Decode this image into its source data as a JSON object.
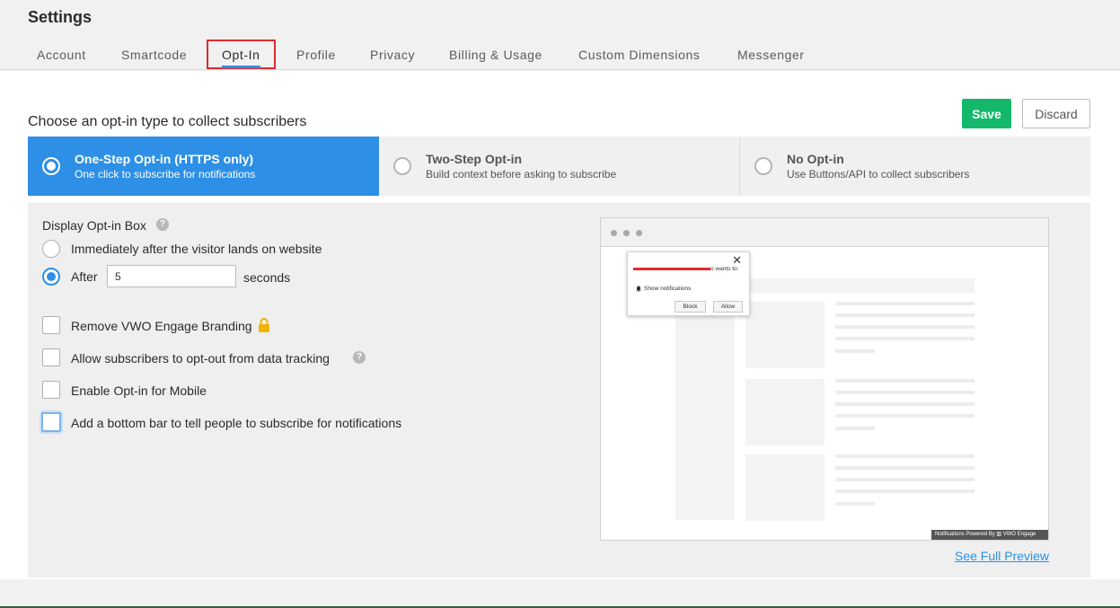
{
  "header": {
    "title": "Settings",
    "tabs": [
      {
        "label": "Account"
      },
      {
        "label": "Smartcode"
      },
      {
        "label": "Opt-In"
      },
      {
        "label": "Profile"
      },
      {
        "label": "Privacy"
      },
      {
        "label": "Billing & Usage"
      },
      {
        "label": "Custom Dimensions"
      },
      {
        "label": "Messenger"
      }
    ],
    "active_tab": "Opt-In"
  },
  "optin": {
    "section_title": "Choose an opt-in type to collect subscribers",
    "save_label": "Save",
    "discard_label": "Discard",
    "types": [
      {
        "title": "One-Step Opt-in (HTTPS only)",
        "desc": "One click to subscribe for notifications",
        "selected": true
      },
      {
        "title": "Two-Step Opt-in",
        "desc": "Build context before asking to subscribe",
        "selected": false
      },
      {
        "title": "No Opt-in",
        "desc": "Use Buttons/API to collect subscribers",
        "selected": false
      }
    ]
  },
  "display": {
    "label": "Display Opt-in Box",
    "help_glyph": "?",
    "option_immediately": "Immediately after the visitor lands on website",
    "option_after": "After",
    "delay_value": "5",
    "delay_unit": "seconds",
    "selected_option": "after"
  },
  "checkboxes": [
    {
      "label": "Remove VWO Engage Branding",
      "checked": false,
      "icon": "lock-icon"
    },
    {
      "label": "Allow subscribers to opt-out from data tracking",
      "checked": false,
      "icon": "help-icon"
    },
    {
      "label": "Enable Opt-in for Mobile",
      "checked": false
    },
    {
      "label": "Add a bottom bar to tell people to subscribe for notifications",
      "checked": false,
      "focused": true
    }
  ],
  "preview": {
    "popup_site_suffix": "o wants to:",
    "popup_show": "Show notifications",
    "popup_close": "✕",
    "block_label": "Block",
    "allow_label": "Allow",
    "powered_by": "Notifications Powered By ▥ VWO Engage",
    "see_full_preview": "See Full Preview"
  },
  "colors": {
    "accent": "#2d8fe6",
    "save": "#14b86b",
    "highlight_border": "#e02a2a",
    "lock": "#f0b400"
  }
}
